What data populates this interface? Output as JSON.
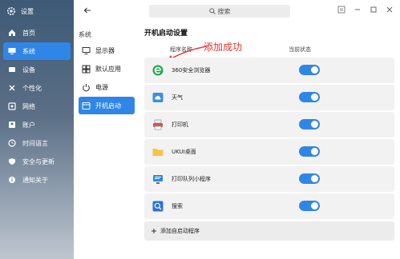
{
  "app": {
    "title": "设置"
  },
  "nav": {
    "items": [
      {
        "label": "首页",
        "icon": "home-icon",
        "active": false
      },
      {
        "label": "系统",
        "icon": "monitor-icon",
        "active": true
      },
      {
        "label": "设备",
        "icon": "device-icon",
        "active": false
      },
      {
        "label": "个性化",
        "icon": "palette-icon",
        "active": false
      },
      {
        "label": "网络",
        "icon": "network-icon",
        "active": false
      },
      {
        "label": "账户",
        "icon": "account-icon",
        "active": false
      },
      {
        "label": "时间语言",
        "icon": "clock-icon",
        "active": false
      },
      {
        "label": "安全与更新",
        "icon": "shield-icon",
        "active": false
      },
      {
        "label": "通知关于",
        "icon": "info-icon",
        "active": false
      }
    ]
  },
  "sub": {
    "section": "系统",
    "items": [
      {
        "label": "显示器",
        "icon": "display-icon",
        "active": false
      },
      {
        "label": "默认应用",
        "icon": "default-apps-icon",
        "active": false
      },
      {
        "label": "电源",
        "icon": "power-icon",
        "active": false
      },
      {
        "label": "开机启动",
        "icon": "startup-icon",
        "active": true
      }
    ]
  },
  "search": {
    "placeholder": "搜索"
  },
  "main": {
    "title": "开机启动设置",
    "col_name": "程序名称",
    "col_state": "当前状态",
    "annotation": "添加成功",
    "apps": [
      {
        "name": "360安全浏览器",
        "icon": "browser-360-icon",
        "enabled": true
      },
      {
        "name": "天气",
        "icon": "weather-icon",
        "enabled": true
      },
      {
        "name": "打印机",
        "icon": "printer-icon",
        "enabled": true
      },
      {
        "name": "UKUI桌面",
        "icon": "folder-icon",
        "enabled": true
      },
      {
        "name": "打印队列小程序",
        "icon": "print-queue-icon",
        "enabled": true
      },
      {
        "name": "搜索",
        "icon": "search-app-icon",
        "enabled": true
      }
    ],
    "add_label": "添加自启动程序"
  },
  "colors": {
    "accent": "#2f86e6",
    "annotation": "#e8332b"
  }
}
